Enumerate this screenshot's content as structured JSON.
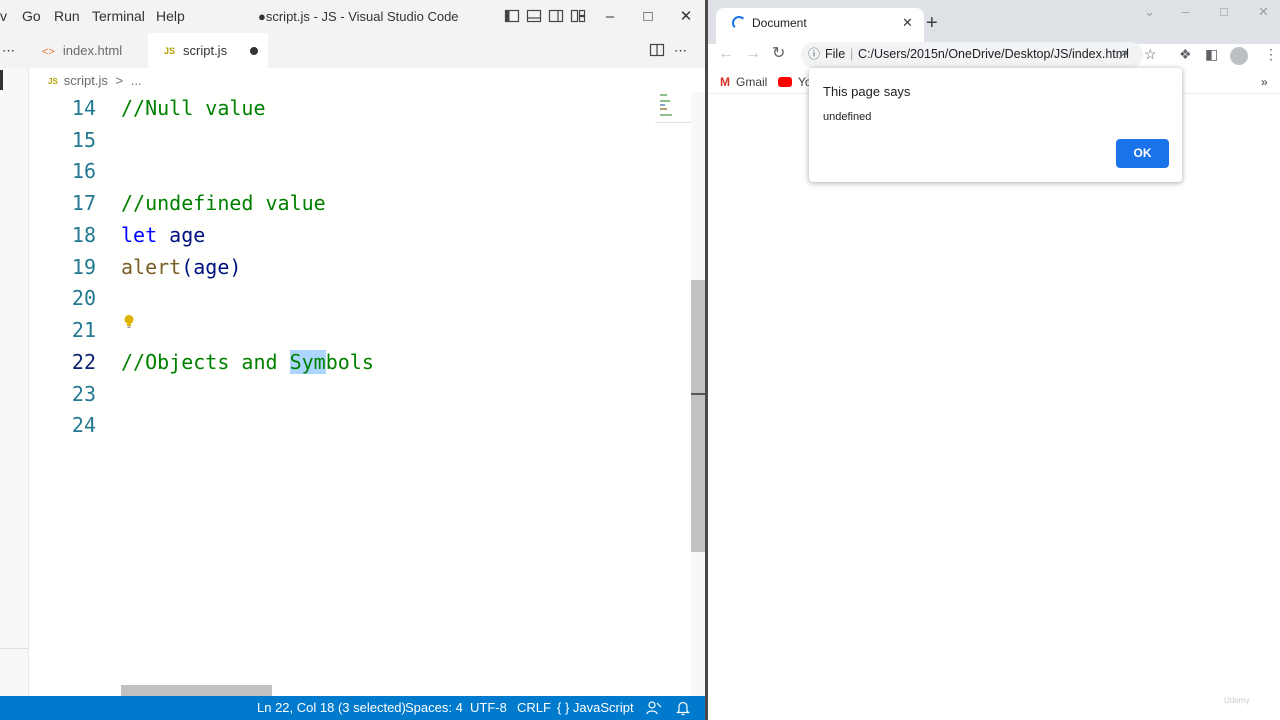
{
  "vscode": {
    "menu": [
      "v",
      "Go",
      "Run",
      "Terminal",
      "Help"
    ],
    "window_title": "●script.js - JS - Visual Studio Code",
    "tabs": [
      {
        "label": "index.html",
        "active": false
      },
      {
        "label": "script.js",
        "active": true,
        "dirty": true
      }
    ],
    "breadcrumb": {
      "file": "script.js",
      "sep": ">",
      "more": "..."
    },
    "editor": {
      "lines": [
        {
          "n": "14"
        },
        {
          "n": "15"
        },
        {
          "n": "16"
        },
        {
          "n": "17"
        },
        {
          "n": "18"
        },
        {
          "n": "19"
        },
        {
          "n": "20"
        },
        {
          "n": "21"
        },
        {
          "n": "22"
        },
        {
          "n": "23"
        },
        {
          "n": "24"
        }
      ],
      "code": {
        "l14": "//Null value",
        "l17": "//undefined value",
        "l18_kw": "let",
        "l18_var": "age",
        "l19_fn": "alert",
        "l19_open": "(",
        "l19_var": "age",
        "l19_close": ")",
        "l22_a": "//Objects and ",
        "l22_sel": "Sym",
        "l22_b": "bols"
      },
      "current_line": "22"
    },
    "statusbar": {
      "position": "Ln 22, Col 18 (3 selected)",
      "spaces": "Spaces: 4",
      "encoding": "UTF-8",
      "eol": "CRLF",
      "language_braces": "{ }",
      "language": "JavaScript"
    }
  },
  "chrome": {
    "tab_title": "Document",
    "close_glyph": "✕",
    "newtab_glyph": "+",
    "omnibox_scheme": "File",
    "omnibox_url": "C:/Users/2015n/OneDrive/Desktop/JS/index.html",
    "bookmarks": [
      {
        "label": "Gmail"
      },
      {
        "label": "Yo"
      }
    ],
    "bookmarks_more": "»",
    "dialog": {
      "title": "This page says",
      "message": "undefined",
      "ok_label": "OK"
    },
    "watermark": "Udemy"
  },
  "colors": {
    "statusbar": "#007acc",
    "comment": "#008000",
    "keyword": "#0000ff",
    "line_number": "#237893",
    "chrome_accent": "#1a73e8"
  }
}
